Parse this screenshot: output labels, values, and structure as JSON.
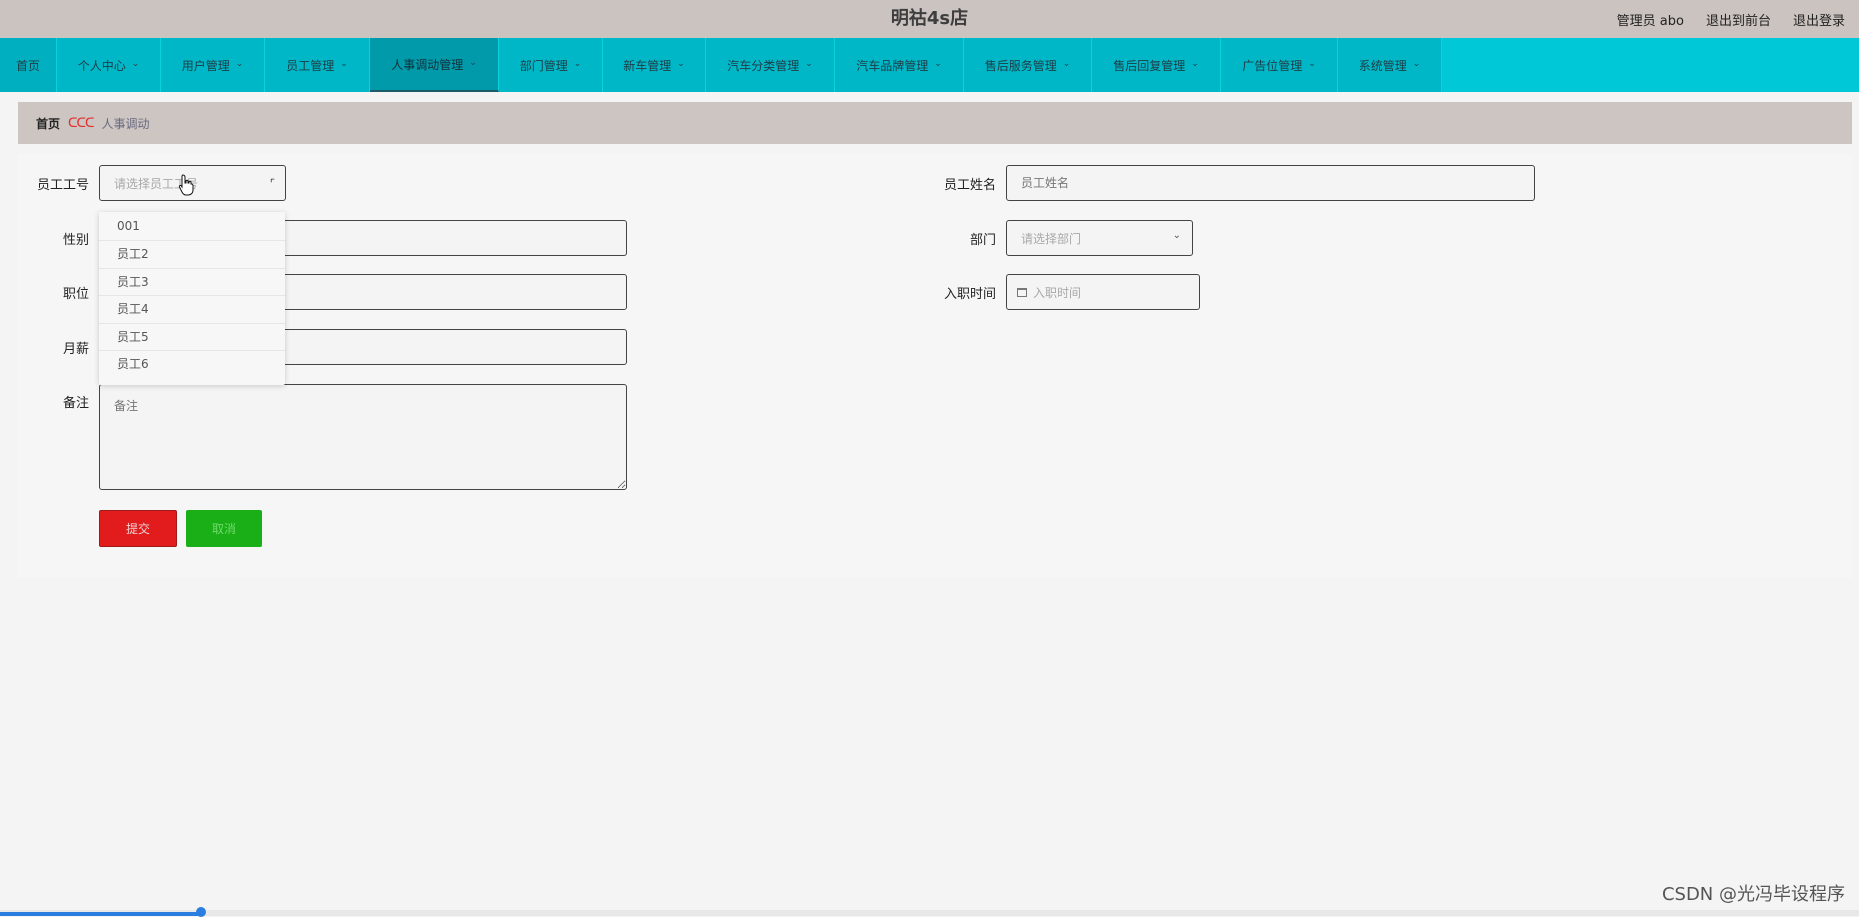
{
  "app": {
    "title": "明祜4s店",
    "user_label": "管理员 abo",
    "front_link": "退出到前台",
    "logout_link": "退出登录"
  },
  "nav": [
    {
      "label": "首页",
      "has_menu": false
    },
    {
      "label": "个人中心",
      "has_menu": true
    },
    {
      "label": "用户管理",
      "has_menu": true
    },
    {
      "label": "员工管理",
      "has_menu": true
    },
    {
      "label": "人事调动管理",
      "has_menu": true,
      "active": true
    },
    {
      "label": "部门管理",
      "has_menu": true
    },
    {
      "label": "新车管理",
      "has_menu": true
    },
    {
      "label": "汽车分类管理",
      "has_menu": true
    },
    {
      "label": "汽车品牌管理",
      "has_menu": true
    },
    {
      "label": "售后服务管理",
      "has_menu": true
    },
    {
      "label": "售后回复管理",
      "has_menu": true
    },
    {
      "label": "广告位管理",
      "has_menu": true
    },
    {
      "label": "系统管理",
      "has_menu": true
    }
  ],
  "breadcrumb": {
    "home": "首页",
    "separator": "ᑕᑕᑕ",
    "current": "人事调动"
  },
  "form": {
    "emp_no_label": "员工工号",
    "emp_no_placeholder": "请选择员工工号",
    "emp_name_label": "员工姓名",
    "emp_name_placeholder": "员工姓名",
    "gender_label": "性别",
    "dept_label": "部门",
    "dept_placeholder": "请选择部门",
    "position_label": "职位",
    "hire_date_label": "入职时间",
    "hire_date_placeholder": "入职时间",
    "salary_label": "月薪",
    "remark_label": "备注",
    "remark_placeholder": "备注",
    "submit_label": "提交",
    "cancel_label": "取消"
  },
  "dropdown_options": [
    "001",
    "员工2",
    "员工3",
    "员工4",
    "员工5",
    "员工6"
  ],
  "watermark": "CSDN @光冯毕设程序",
  "colors": {
    "nav_bg": "#00c8d6",
    "submit": "#e21c1c",
    "cancel": "#1aaf16"
  }
}
